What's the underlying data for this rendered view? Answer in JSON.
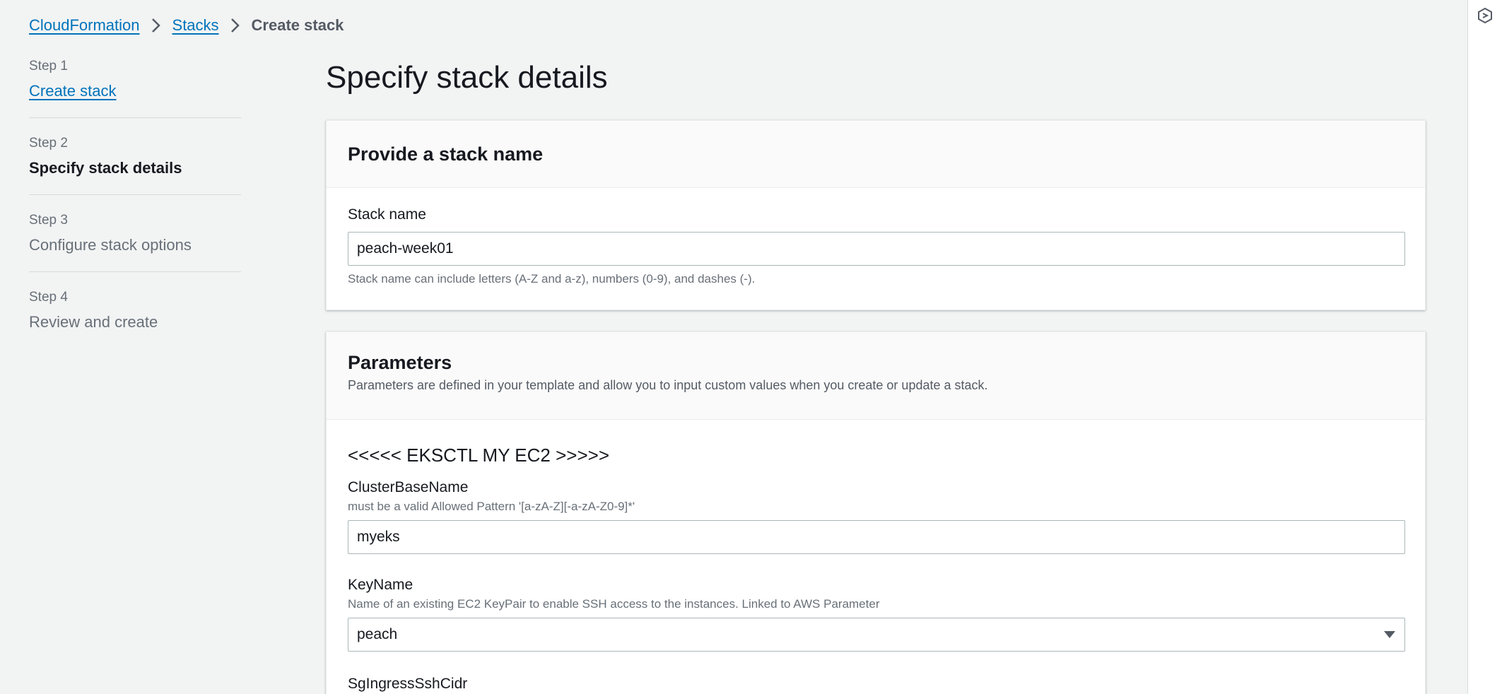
{
  "breadcrumb": {
    "items": [
      "CloudFormation",
      "Stacks"
    ],
    "current": "Create stack"
  },
  "steps": [
    {
      "num": "Step 1",
      "title": "Create stack"
    },
    {
      "num": "Step 2",
      "title": "Specify stack details"
    },
    {
      "num": "Step 3",
      "title": "Configure stack options"
    },
    {
      "num": "Step 4",
      "title": "Review and create"
    }
  ],
  "main": {
    "title": "Specify stack details"
  },
  "stack_name_panel": {
    "title": "Provide a stack name",
    "label": "Stack name",
    "value": "peach-week01",
    "hint": "Stack name can include letters (A-Z and a-z), numbers (0-9), and dashes (-)."
  },
  "parameters_panel": {
    "title": "Parameters",
    "description": "Parameters are defined in your template and allow you to input custom values when you create or update a stack.",
    "group_heading": "<<<<< EKSCTL MY EC2 >>>>>",
    "cluster": {
      "label": "ClusterBaseName",
      "desc": "must be a valid Allowed Pattern '[a-zA-Z][-a-zA-Z0-9]*'",
      "value": "myeks"
    },
    "keyname": {
      "label": "KeyName",
      "desc": "Name of an existing EC2 KeyPair to enable SSH access to the instances. Linked to AWS Parameter",
      "value": "peach"
    },
    "sgingress": {
      "label": "SgIngressSshCidr"
    }
  },
  "icons": {
    "breadcrumb_separator": "chevron-right-icon",
    "select_caret": "caret-down-icon",
    "rail": "settings-hex-icon"
  },
  "colors": {
    "link": "#0073bb",
    "background": "#f2f3f3",
    "panel_header": "#fafafa"
  }
}
